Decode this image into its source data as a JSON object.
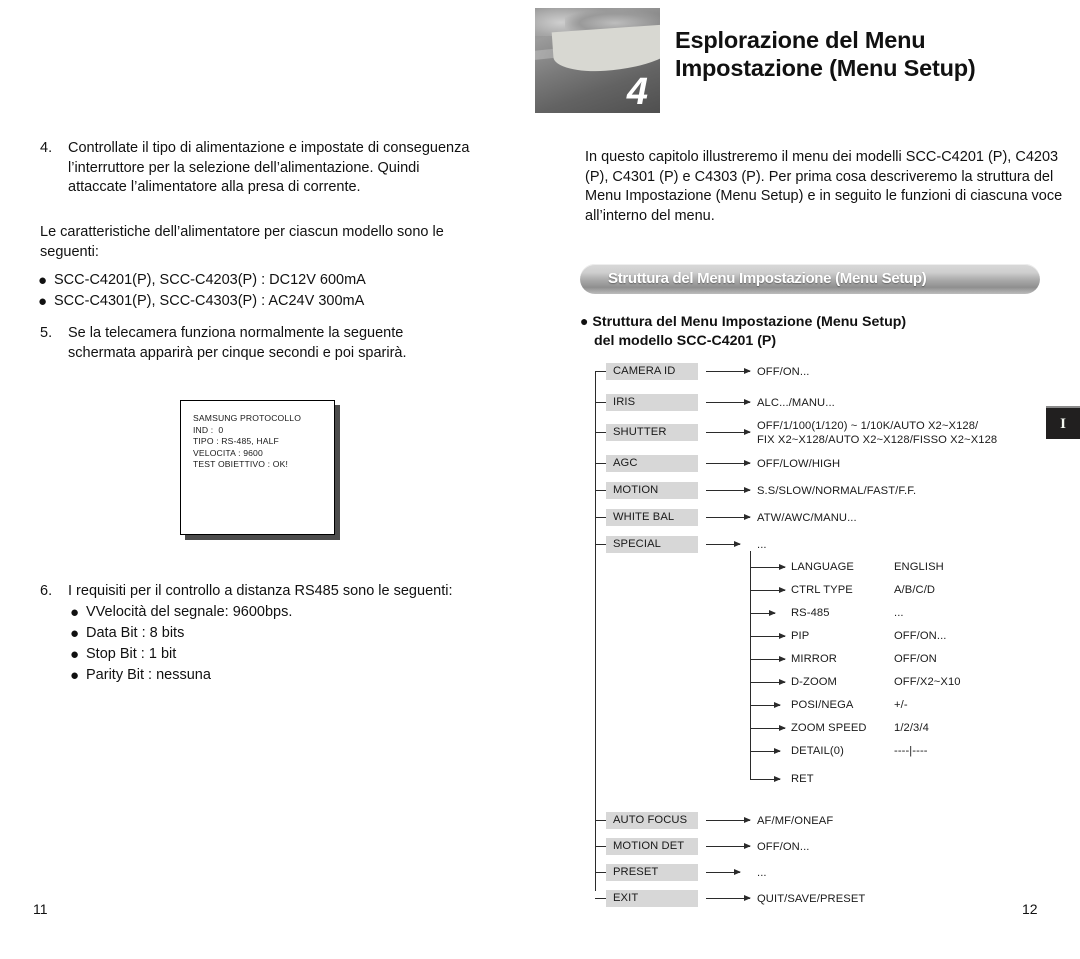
{
  "left_page": {
    "page_number": "11",
    "item4": {
      "number": "4.",
      "text": "Controllate il tipo di alimentazione e impostate di conseguenza l’interruttore per la selezione dell’alimentazione. Quindi attaccate l’alimentatore alla presa di corrente."
    },
    "para1": "Le caratteristiche dell’alimentatore per ciascun modello sono le seguenti:",
    "power_specs": [
      "SCC-C4201(P), SCC-C4203(P) : DC12V 600mA",
      "SCC-C4301(P), SCC-C4303(P) : AC24V 300mA"
    ],
    "item5": {
      "number": "5.",
      "text": "Se la telecamera funziona normalmente la seguente schermata apparirà per cinque secondi e poi sparirà."
    },
    "osd_screen": {
      "lines": [
        "SAMSUNG PROTOCOLLO",
        "IND :  0",
        "TIPO : RS-485, HALF",
        "VELOCITA : 9600",
        "TEST OBIETTIVO : OK!"
      ]
    },
    "item6": {
      "number": "6.",
      "text": "I requisiti per il controllo a distanza RS485 sono le seguenti:",
      "bullets": [
        "VVelocità del segnale: 9600bps.",
        "Data Bit : 8 bits",
        "Stop Bit : 1 bit",
        "Parity Bit : nessuna"
      ]
    }
  },
  "right_page": {
    "page_number": "12",
    "chapter": {
      "number": "4",
      "title_line1": "Esplorazione del Menu",
      "title_line2": "Impostazione (Menu Setup)"
    },
    "intro": "In questo capitolo illustreremo il menu dei modelli SCC-C4201 (P), C4203 (P), C4301 (P) e C4303 (P). Per prima cosa descriveremo la struttura del Menu Impostazione (Menu Setup) e in seguito le funzioni di ciascuna voce all’interno del menu.",
    "section_banner": "Struttura del Menu Impostazione (Menu Setup)",
    "sub_heading_line1": "Struttura del Menu Impostazione (Menu Setup)",
    "sub_heading_line2": "del modello SCC-C4201 (P)",
    "side_tab": "I"
  },
  "menu_tree": {
    "top_items": [
      {
        "label": "CAMERA ID",
        "value": "OFF/ON..."
      },
      {
        "label": "IRIS",
        "value": "ALC.../MANU..."
      },
      {
        "label": "SHUTTER",
        "value": "OFF/1/100(1/120) ~ 1/10K/AUTO X2~X128/\nFIX X2~X128/AUTO X2~X128/FISSO X2~X128"
      },
      {
        "label": "AGC",
        "value": "OFF/LOW/HIGH"
      },
      {
        "label": "MOTION",
        "value": "S.S/SLOW/NORMAL/FAST/F.F."
      },
      {
        "label": "WHITE BAL",
        "value": "ATW/AWC/MANU..."
      },
      {
        "label": "SPECIAL",
        "value": "..."
      }
    ],
    "special_submenu": [
      {
        "label": "LANGUAGE",
        "value": "ENGLISH"
      },
      {
        "label": "CTRL TYPE",
        "value": "A/B/C/D"
      },
      {
        "label": "RS-485",
        "value": "..."
      },
      {
        "label": "PIP",
        "value": "OFF/ON..."
      },
      {
        "label": "MIRROR",
        "value": "OFF/ON"
      },
      {
        "label": "D-ZOOM",
        "value": "OFF/X2~X10"
      },
      {
        "label": "POSI/NEGA",
        "value": "+/-"
      },
      {
        "label": "ZOOM SPEED",
        "value": "1/2/3/4"
      },
      {
        "label": "DETAIL(0)",
        "value": "----|----"
      },
      {
        "label": "RET",
        "value": ""
      }
    ],
    "bottom_items": [
      {
        "label": "AUTO FOCUS",
        "value": "AF/MF/ONEAF"
      },
      {
        "label": "MOTION DET",
        "value": "OFF/ON..."
      },
      {
        "label": "PRESET",
        "value": "..."
      },
      {
        "label": "EXIT",
        "value": "QUIT/SAVE/PRESET"
      }
    ]
  }
}
